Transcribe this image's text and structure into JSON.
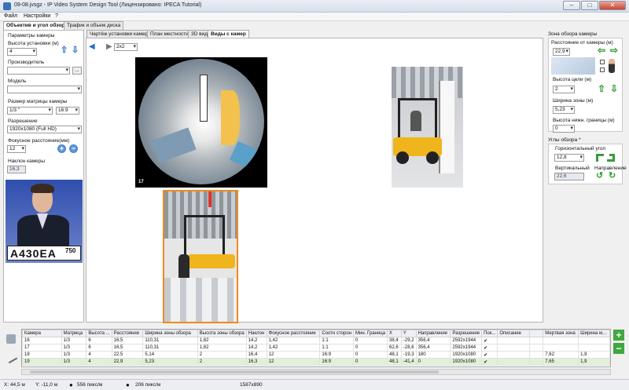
{
  "window": {
    "title": "09-08.jvsgz - IP Video System Design Tool (Лицензировано: IPECA Tutorial)",
    "minimize": "–",
    "maximize": "□",
    "close": "✕"
  },
  "menu": [
    "Файл",
    "Настройки",
    "?"
  ],
  "left_tabs": [
    "Объектив и угол обзора",
    "Трафик и объем диска"
  ],
  "left": {
    "section_title": "Параметры камеры",
    "height_label": "Высота установки (м)",
    "height_value": "4",
    "vendor_label": "Производитель",
    "vendor_value": "",
    "vendor_button": "...",
    "model_label": "Модель",
    "model_value": "",
    "sensor_label": "Размер матрицы камеры",
    "sensor_value": "1/3 \"",
    "aspect_value": "16:9",
    "resolution_label": "Разрешение",
    "resolution_value": "1920x1080 (Full HD)",
    "focal_label": "Фокусное расстояние(мм)",
    "focal_value": "12",
    "tilt_label": "Наклон камеры",
    "tilt_value": "16,3",
    "plate_text": "А430ЕА",
    "plate_region": "750"
  },
  "center_tabs": [
    "Чертёж установки камеры",
    "План местности",
    "3D вид",
    "Виды с камер"
  ],
  "center": {
    "layout_value": "2x2",
    "view_label": "17"
  },
  "right": {
    "zone_title": "Зона обзора камеры",
    "distance_label": "Расстояние от камеры (м)",
    "distance_value": "22,9",
    "target_height_label": "Высота цели (м)",
    "target_height_value": "2",
    "zone_width_label": "Ширина зоны (м)",
    "zone_width_value": "5,23",
    "lower_bound_label": "Высота нижн. границы (м)",
    "lower_bound_value": "0",
    "angles_title": "Углы обзора *",
    "horizontal_label": "Горизонтальный угол",
    "horizontal_value": "12,8",
    "vertical_label": "Вертикальный",
    "vertical_value": "22,6",
    "direction_label": "Направление"
  },
  "table": {
    "headers": [
      "Камера",
      "Матрица",
      "Высота ...",
      "Расстояние",
      "Ширина зоны обзора",
      "Высота зоны обзора",
      "Наклон",
      "Фокусное расстояние",
      "Соотн сторон",
      "Мин. Граница",
      "X",
      "Y",
      "Направление",
      "Разрешение",
      "Пок...",
      "Описание",
      "",
      "Мертвая зона",
      "Ширина м..."
    ],
    "rows": [
      [
        "16",
        "1/3",
        "6",
        "16,5",
        "110,31",
        "1,82",
        "14,2",
        "1,42",
        "1:1",
        "0",
        "38,4",
        "-29,2",
        "356,4",
        "2592x1944",
        "✔",
        "",
        "",
        "",
        ""
      ],
      [
        "17",
        "1/3",
        "6",
        "16,5",
        "110,31",
        "1,82",
        "14,2",
        "1,42",
        "1:1",
        "0",
        "62,6",
        "-28,6",
        "356,4",
        "2592x1944",
        "✔",
        "",
        "",
        "",
        ""
      ],
      [
        "18",
        "1/3",
        "4",
        "22,5",
        "5,14",
        "2",
        "16,4",
        "12",
        "16:9",
        "0",
        "48,1",
        "-19,3",
        "180",
        "1920x1080",
        "✔",
        "",
        "",
        "7,62",
        "1,9"
      ],
      [
        "19",
        "1/3",
        "4",
        "22,9",
        "5,23",
        "2",
        "16,3",
        "12",
        "16:9",
        "0",
        "48,1",
        "-41,4",
        "0",
        "1920x1080",
        "✔",
        "",
        "",
        "7,65",
        "1,9"
      ]
    ]
  },
  "status": {
    "x": "X: 44,5 м",
    "y": "Y: -11,0 м",
    "density1": "556 пикс/м",
    "density2": "206 пикс/м",
    "resolution": "1587x890"
  }
}
